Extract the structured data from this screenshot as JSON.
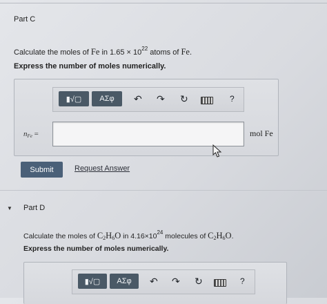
{
  "part_c": {
    "title": "Part C",
    "question": {
      "prefix": "Calculate the moles of ",
      "element": "Fe",
      "mid": " in 1.65 × 10",
      "exponent": "22",
      "suffix": " atoms of ",
      "element2": "Fe",
      "end": "."
    },
    "instruction": "Express the number of moles numerically.",
    "toolbar": {
      "templates_label": "▮√▢",
      "greek_label": "ΑΣφ",
      "undo": "↶",
      "redo": "↷",
      "reset": "↻",
      "help": "?"
    },
    "answer": {
      "var_main": "n",
      "var_sub": "Fe",
      "equals": "=",
      "value": "",
      "unit": "mol Fe"
    },
    "submit_label": "Submit",
    "request_label": "Request Answer"
  },
  "part_d": {
    "title": "Part D",
    "question": {
      "prefix": "Calculate the moles of ",
      "formula_a": "C",
      "sub_a": "2",
      "formula_b": "H",
      "sub_b": "6",
      "formula_c": "O",
      "mid": " in 4.16×10",
      "exponent": "24",
      "suffix": " molecules of ",
      "end": "."
    },
    "instruction": "Express the number of moles numerically.",
    "toolbar": {
      "templates_label": "▮√▢",
      "greek_label": "ΑΣφ",
      "undo": "↶",
      "redo": "↷",
      "reset": "↻",
      "help": "?"
    }
  },
  "colors": {
    "toolbar_button": "#4a5966",
    "submit": "#4a6078",
    "background": "#dcdee2"
  }
}
